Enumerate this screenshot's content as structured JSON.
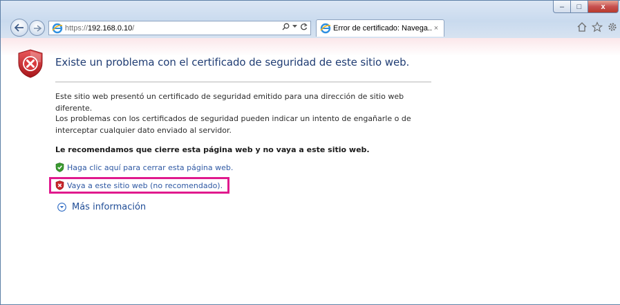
{
  "browser": {
    "address": {
      "scheme": "https://",
      "host": "192.168.0.10",
      "path": "/",
      "search_icon": "search-icon",
      "refresh_icon": "refresh-icon"
    },
    "tab": {
      "title": "Error de certificado: Navega...",
      "close": "×"
    },
    "window_controls": {
      "minimize": "–",
      "maximize": "□",
      "close": "x"
    },
    "toolbar_icons": [
      "home-icon",
      "favorites-star-icon",
      "settings-gear-icon"
    ]
  },
  "page": {
    "title": "Existe un problema con el certificado de seguridad de este sitio web.",
    "paragraph_1": "Este sitio web presentó un certificado de seguridad emitido para una dirección de sitio web diferente.",
    "paragraph_2": "Los problemas con los certificados de seguridad pueden indicar un intento de engañarle o de interceptar cualquier dato enviado al servidor.",
    "recommendation": "Le recomendamos que cierre esta página web y no vaya a este sitio web.",
    "option_close": "Haga clic aquí para cerrar esta página web.",
    "option_continue": "Vaya a este sitio web (no recomendado).",
    "more_info": "Más información"
  },
  "colors": {
    "title": "#1f3c73",
    "link": "#2e58a3",
    "highlight": "#e0198d",
    "shield_red": "#c8262a",
    "shield_green": "#3a9a2f"
  }
}
